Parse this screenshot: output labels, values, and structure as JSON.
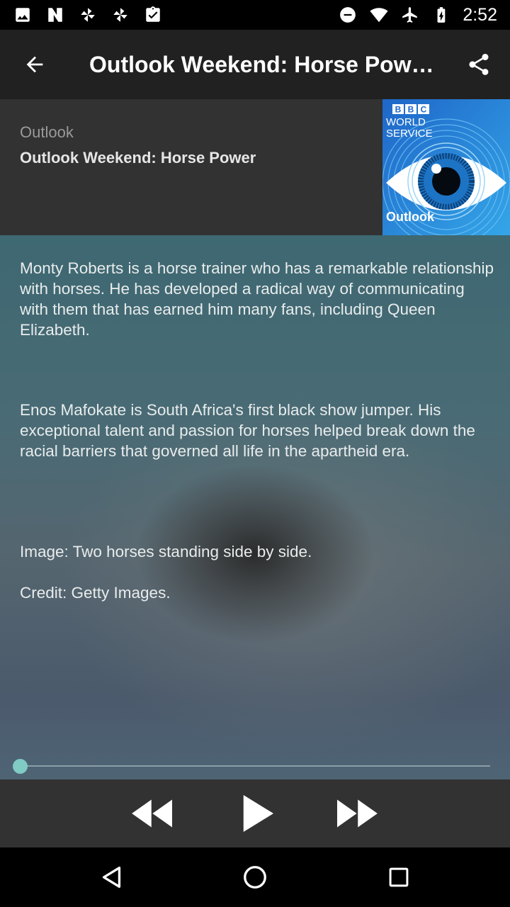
{
  "status_bar": {
    "time": "2:52",
    "left_icons": [
      "image-icon",
      "notification-n-icon",
      "pinwheel-icon",
      "pinwheel-icon",
      "clipboard-check-icon"
    ],
    "right_icons": [
      "do-not-disturb-icon",
      "wifi-icon",
      "airplane-icon",
      "battery-charging-icon"
    ]
  },
  "app_bar": {
    "title": "Outlook Weekend: Horse Pow…",
    "back_icon": "arrow-back-icon",
    "share_icon": "share-icon"
  },
  "episode": {
    "program": "Outlook",
    "title": "Outlook Weekend: Horse Power",
    "artwork": {
      "bbc_letters": [
        "B",
        "B",
        "C"
      ],
      "service_line1": "WORLD",
      "service_line2": "SERVICE",
      "show_name": "Outlook"
    }
  },
  "description": {
    "para1": "Monty Roberts is a horse trainer who has a remarkable relationship with horses. He has developed a radical way of communicating with them that has earned him many fans, including Queen Elizabeth.",
    "para2": "Enos Mafokate is South Africa's first black show jumper. His exceptional talent and passion for horses helped break down the racial barriers that governed all life in the apartheid era.",
    "image_caption": "Image: Two horses standing side by side.",
    "credit": "Credit: Getty Images."
  },
  "player": {
    "progress": 0,
    "controls": [
      "rewind-icon",
      "play-icon",
      "fast-forward-icon"
    ]
  },
  "nav_bar": {
    "buttons": [
      "back-triangle-icon",
      "home-circle-icon",
      "recents-square-icon"
    ]
  },
  "colors": {
    "app_bar": "#212121",
    "header_card": "#323232",
    "accent_thumb": "#80cbc4",
    "artwork_blue": "#2f7fd6"
  }
}
